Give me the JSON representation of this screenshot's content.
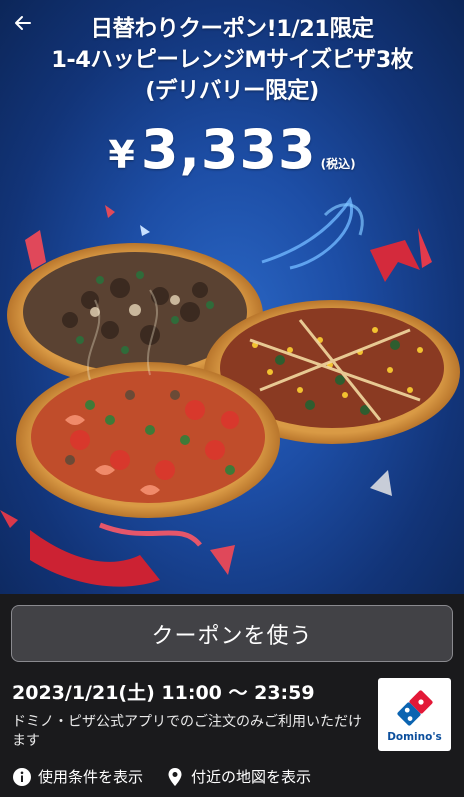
{
  "hero": {
    "headline_line1": "日替わりクーポン!1/21限定",
    "headline_line2": "1-4ハッピーレンジMサイズピザ3枚",
    "headline_line3": "(デリバリー限定)",
    "price_symbol": "¥",
    "price": "3,333",
    "price_tax_note": "(税込)"
  },
  "coupon_button_label": "クーポンを使う",
  "validity": "2023/1/21(土) 11:00 〜 23:59",
  "note": "ドミノ・ピザ公式アプリでのご注文のみご利用いただけます",
  "brand": {
    "logo_text": "Domino's",
    "blue": "#0b64b1",
    "red": "#e31837"
  },
  "links": {
    "terms_label": "使用条件を表示",
    "terms_icon": "info-icon",
    "map_label": "付近の地図を表示",
    "map_icon": "map-pin-icon"
  },
  "colors": {
    "background": "#1a1a1c",
    "button": "#424246",
    "hero_blue": "#1d4ea6"
  }
}
